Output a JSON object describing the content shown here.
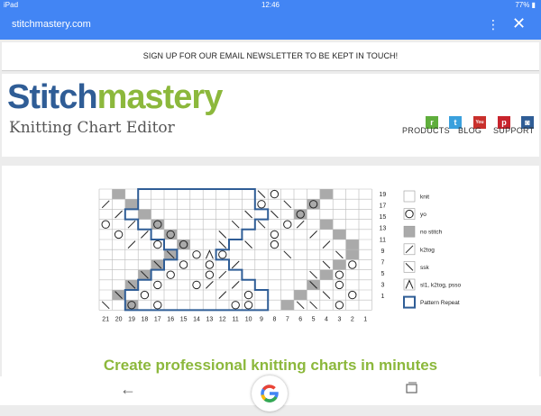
{
  "status_bar": {
    "carrier": "iPad",
    "time": "12:46",
    "battery": "77%"
  },
  "browser": {
    "url": "stitchmastery.com"
  },
  "newsletter": {
    "text": "SIGN UP FOR OUR EMAIL NEWSLETTER TO BE KEPT IN TOUCH!"
  },
  "header": {
    "logo_part1": "Stitch",
    "logo_part2": "mastery",
    "tagline": "Knitting Chart Editor",
    "social": [
      {
        "name": "ravelry",
        "glyph": "r",
        "color": "#5fae3c"
      },
      {
        "name": "twitter",
        "glyph": "t",
        "color": "#3aa0dd"
      },
      {
        "name": "youtube",
        "glyph": "You",
        "color": "#c9302c"
      },
      {
        "name": "pinterest",
        "glyph": "p",
        "color": "#c8232c"
      },
      {
        "name": "instagram",
        "glyph": "◙",
        "color": "#2f5d96"
      }
    ],
    "nav": [
      "PRODUCTS",
      "BLOG",
      "SUPPORT"
    ]
  },
  "chart_data": {
    "type": "table",
    "columns": [
      "21",
      "20",
      "19",
      "18",
      "17",
      "16",
      "15",
      "14",
      "13",
      "12",
      "11",
      "10",
      "9",
      "8",
      "7",
      "6",
      "5",
      "4",
      "3",
      "2",
      "1"
    ],
    "row_labels_right": [
      "19",
      "17",
      "15",
      "13",
      "11",
      "9",
      "7",
      "5",
      "3",
      "1"
    ],
    "legend": [
      {
        "symbol": "knit",
        "label": "knit"
      },
      {
        "symbol": "yo",
        "label": "yo"
      },
      {
        "symbol": "no-stitch",
        "label": "no stitch"
      },
      {
        "symbol": "k2tog",
        "label": "k2tog"
      },
      {
        "symbol": "ssk",
        "label": "ssk"
      },
      {
        "symbol": "sl1k2togpsso",
        "label": "sl1, k2tog, psso"
      },
      {
        "symbol": "repeat",
        "label": "Pattern Repeat"
      }
    ],
    "colors": {
      "grid": "#bbbbbb",
      "gray": "#aaaaaa",
      "repeat": "#2f5d96"
    }
  },
  "headline": "Create professional knitting charts in minutes"
}
